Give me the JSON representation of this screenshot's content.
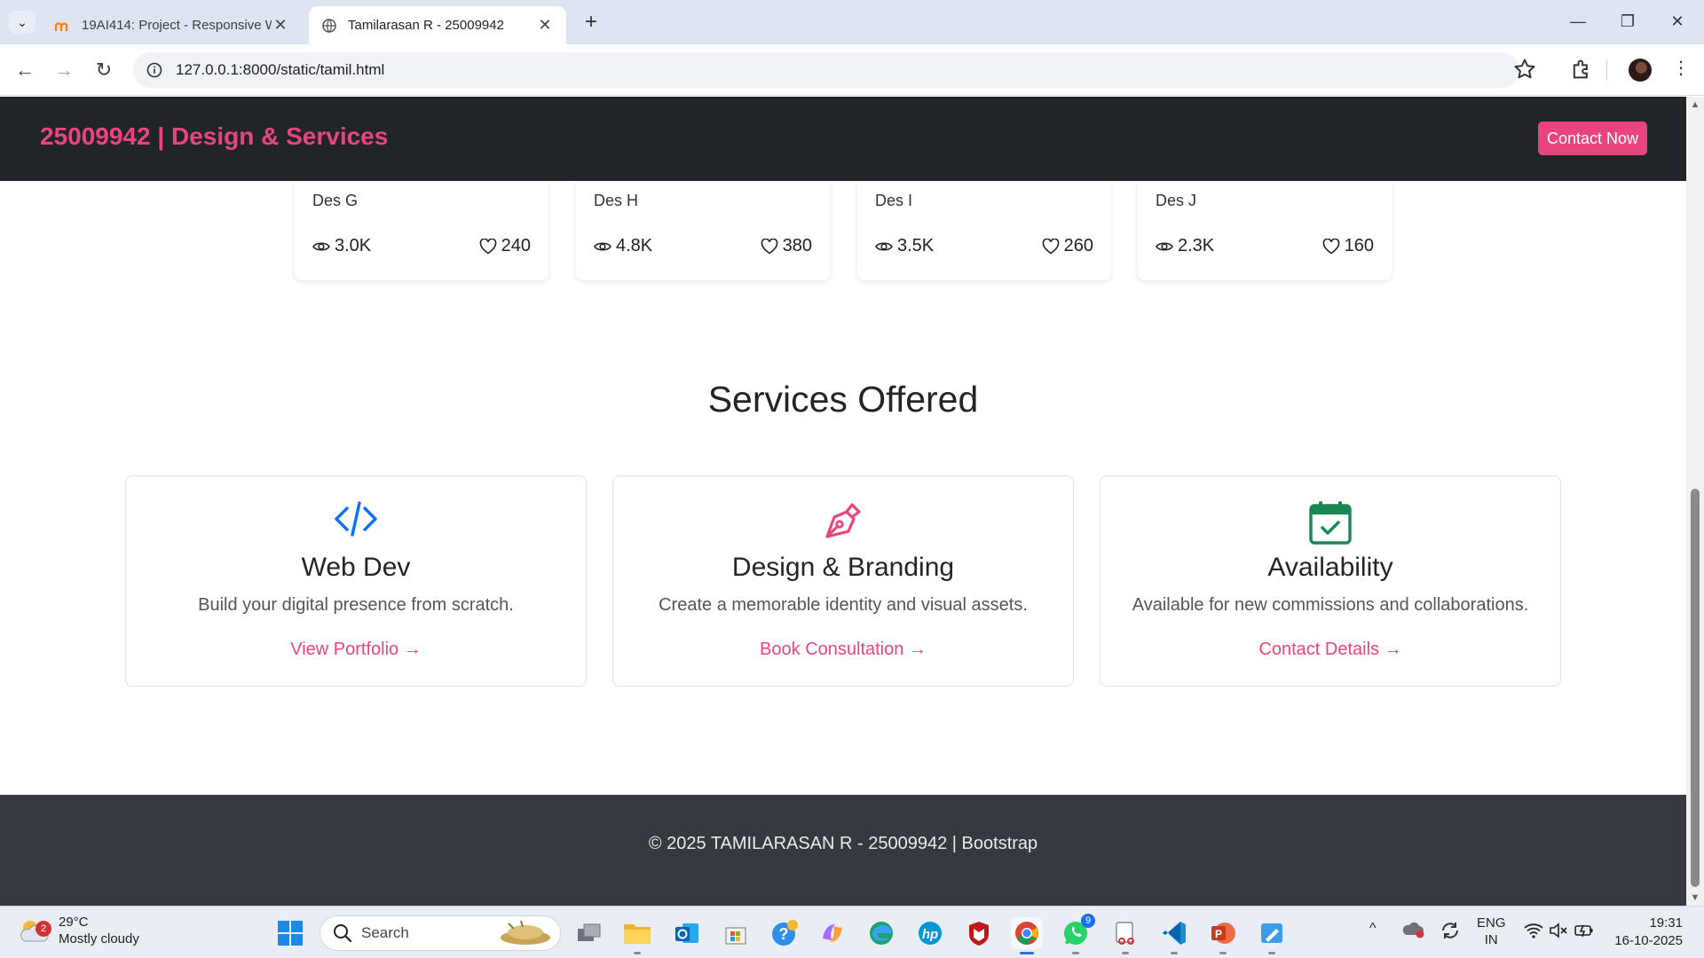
{
  "browser": {
    "tabs": [
      {
        "title": "19AI414: Project - Responsive W",
        "active": false
      },
      {
        "title": "Tamilarasan R - 25009942",
        "active": true
      }
    ],
    "url": "127.0.0.1:8000/static/tamil.html"
  },
  "site": {
    "brand": "25009942 | Design & Services",
    "contact_button": "Contact Now",
    "brand_color": "#e8457f",
    "design_cards": [
      {
        "name": "Des G",
        "views": "3.0K",
        "likes": "240"
      },
      {
        "name": "Des H",
        "views": "4.8K",
        "likes": "380"
      },
      {
        "name": "Des I",
        "views": "3.5K",
        "likes": "260"
      },
      {
        "name": "Des J",
        "views": "2.3K",
        "likes": "160"
      }
    ],
    "services_title": "Services Offered",
    "services": [
      {
        "icon": "code-icon",
        "title": "Web Dev",
        "desc": "Build your digital presence from scratch.",
        "link": "View Portfolio →"
      },
      {
        "icon": "pen-nib-icon",
        "title": "Design & Branding",
        "desc": "Create a memorable identity and visual assets.",
        "link": "Book Consultation →"
      },
      {
        "icon": "calendar-check-icon",
        "title": "Availability",
        "desc": "Available for new commissions and collaborations.",
        "link": "Contact Details →"
      }
    ],
    "footer": "© 2025 TAMILARASAN R - 25009942 | Bootstrap"
  },
  "taskbar": {
    "weather_badge": "2",
    "temperature": "29°C",
    "condition": "Mostly cloudy",
    "search_placeholder": "Search",
    "whatsapp_badge": "9",
    "lang_top": "ENG",
    "lang_bottom": "IN",
    "time": "19:31",
    "date": "16-10-2025"
  }
}
